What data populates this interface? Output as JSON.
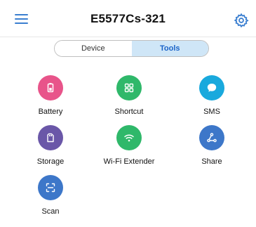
{
  "header": {
    "title": "E5577Cs-321"
  },
  "tabs": [
    {
      "label": "Device",
      "active": false
    },
    {
      "label": "Tools",
      "active": true
    }
  ],
  "tools": [
    {
      "label": "Battery",
      "icon": "battery-icon",
      "color": "#e8548a"
    },
    {
      "label": "Shortcut",
      "icon": "shortcut-icon",
      "color": "#2fb86a"
    },
    {
      "label": "SMS",
      "icon": "sms-icon",
      "color": "#19a9dd"
    },
    {
      "label": "Storage",
      "icon": "storage-icon",
      "color": "#6a57a8"
    },
    {
      "label": "Wi-Fi Extender",
      "icon": "wifi-icon",
      "color": "#2fb86a"
    },
    {
      "label": "Share",
      "icon": "share-icon",
      "color": "#3d77c9"
    },
    {
      "label": "Scan",
      "icon": "scan-icon",
      "color": "#3d77c9"
    }
  ],
  "colors": {
    "accent": "#3b7fd0",
    "active_tab_bg": "#cfe6f7"
  }
}
